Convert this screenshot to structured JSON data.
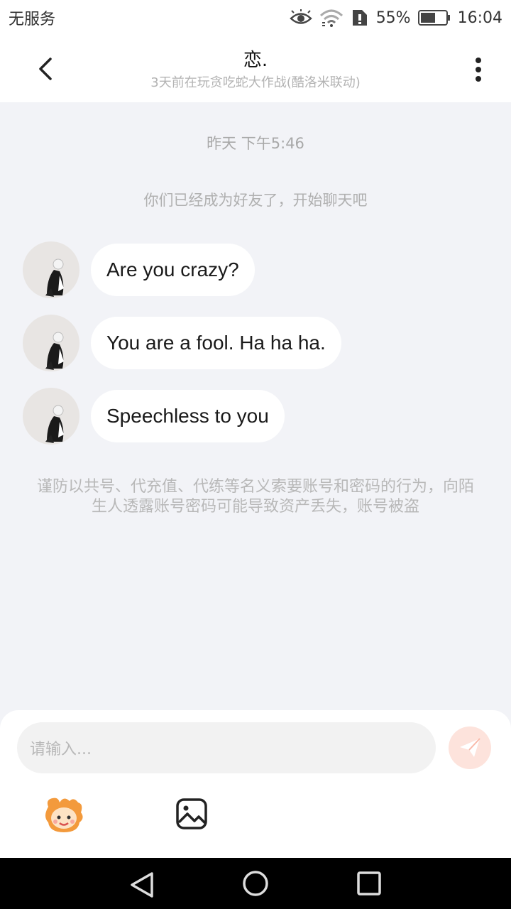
{
  "status_bar": {
    "carrier": "无服务",
    "battery": "55%",
    "time": "16:04"
  },
  "header": {
    "title": "恋.",
    "subtitle": "3天前在玩贪吃蛇大作战(酷洛米联动)"
  },
  "chat": {
    "timestamp": "昨天 下午5:46",
    "system_message": "你们已经成为好友了，开始聊天吧",
    "messages": [
      {
        "text": "Are you crazy?"
      },
      {
        "text": "You are a fool. Ha ha ha."
      },
      {
        "text": "Speechless to you"
      }
    ],
    "warning": "谨防以共号、代充值、代练等名义索要账号和密码的行为，向陌生人透露账号密码可能导致资产丢失，账号被盗"
  },
  "composer": {
    "placeholder": "请输入..."
  },
  "colors": {
    "accent": "#f26b4e",
    "background": "#f2f3f7"
  },
  "icons": [
    "eye-icon",
    "wifi-icon",
    "sim-alert-icon",
    "battery-icon",
    "back-icon",
    "more-icon",
    "send-icon",
    "emoji-icon",
    "image-icon",
    "nav-back-icon",
    "nav-home-icon",
    "nav-recent-icon"
  ]
}
